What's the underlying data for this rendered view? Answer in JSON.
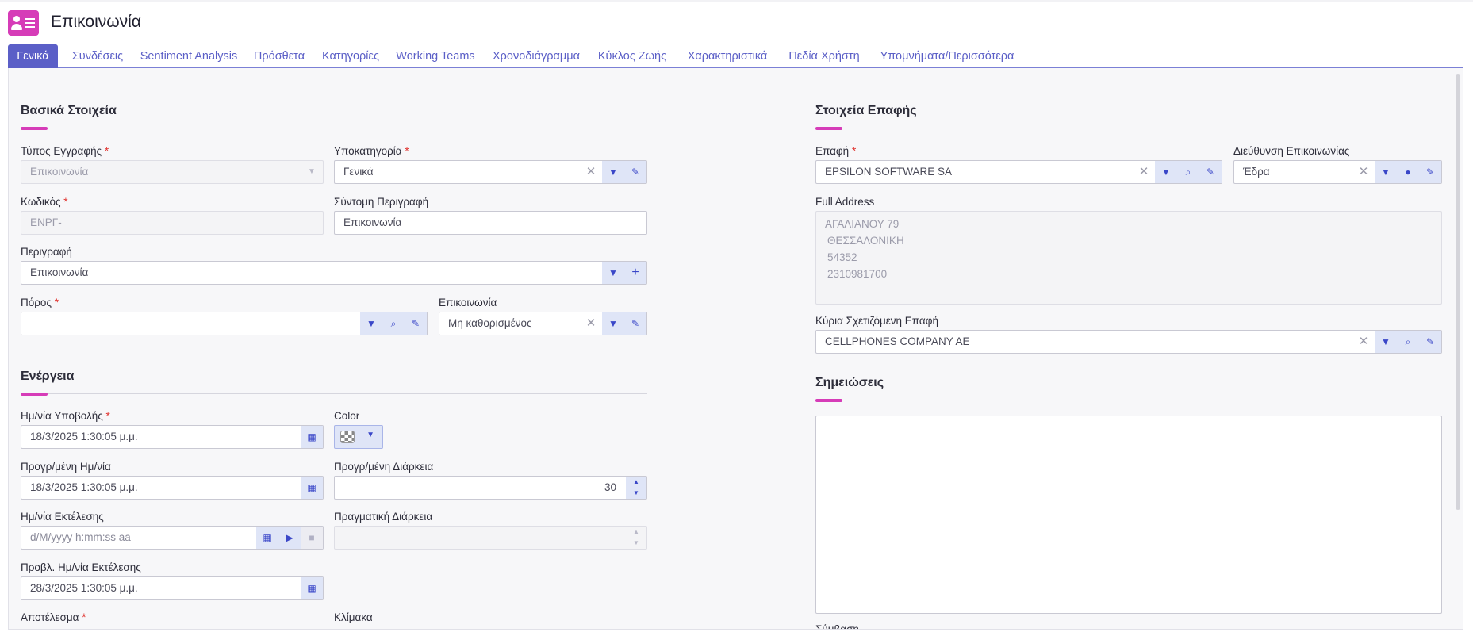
{
  "header": {
    "title": "Επικοινωνία",
    "icon": "contact-card-icon"
  },
  "tabs": [
    {
      "label": "Γενικά",
      "active": true
    },
    {
      "label": "Συνδέσεις"
    },
    {
      "label": "Sentiment Analysis"
    },
    {
      "label": "Πρόσθετα"
    },
    {
      "label": "Κατηγορίες"
    },
    {
      "label": "Working Teams"
    },
    {
      "label": "Χρονοδιάγραμμα"
    },
    {
      "label": "Κύκλος Ζωής"
    },
    {
      "label": "Χαρακτηριστικά"
    },
    {
      "label": "Πεδία Χρήστη"
    },
    {
      "label": "Υπομνήματα/Περισσότερα"
    }
  ],
  "basic": {
    "title": "Βασικά Στοιχεία",
    "record_type": {
      "label": "Τύπος Εγγραφής",
      "value": "Επικοινωνία"
    },
    "subcategory": {
      "label": "Υποκατηγορία",
      "value": "Γενικά"
    },
    "code": {
      "label": "Κωδικός",
      "value": "ΕΝΡΓ-________"
    },
    "short_desc": {
      "label": "Σύντομη Περιγραφή",
      "value": "Επικοινωνία"
    },
    "description": {
      "label": "Περιγραφή",
      "value": "Επικοινωνία"
    },
    "resource": {
      "label": "Πόρος",
      "value": ""
    },
    "communication": {
      "label": "Επικοινωνία",
      "value": "Μη καθορισμένος"
    }
  },
  "action": {
    "title": "Ενέργεια",
    "submit_date": {
      "label": "Ημ/νία Υποβολής",
      "value": "18/3/2025 1:30:05 μ.μ."
    },
    "color": {
      "label": "Color"
    },
    "planned_date": {
      "label": "Προγρ/μένη Ημ/νία",
      "value": "18/3/2025 1:30:05 μ.μ."
    },
    "planned_duration": {
      "label": "Προγρ/μένη Διάρκεια",
      "value": "30"
    },
    "exec_date": {
      "label": "Ημ/νία Εκτέλεσης",
      "placeholder": "d/M/yyyy h:mm:ss aa"
    },
    "actual_duration": {
      "label": "Πραγματική Διάρκεια",
      "value": ""
    },
    "forecast_exec_date": {
      "label": "Προβλ. Ημ/νία Εκτέλεσης",
      "value": "28/3/2025 1:30:05 μ.μ."
    },
    "result": {
      "label": "Αποτέλεσμα"
    },
    "scale": {
      "label": "Κλίμακα"
    }
  },
  "contact": {
    "title": "Στοιχεία Επαφής",
    "contact": {
      "label": "Επαφή",
      "value": "EPSILON SOFTWARE SA"
    },
    "address": {
      "label": "Διεύθυνση Επικοινωνίας",
      "value": "Έδρα"
    },
    "full_address": {
      "label": "Full Address",
      "lines": [
        "ΑΓΑΛΙΑΝΟΥ 79",
        "ΘΕΣΣΑΛΟΝΙΚΗ",
        "54352",
        "2310981700"
      ]
    },
    "main_related": {
      "label": "Κύρια Σχετιζόμενη Επαφή",
      "value": "CELLPHONES COMPANY AE"
    }
  },
  "notes": {
    "title": "Σημειώσεις",
    "value": ""
  },
  "contract": {
    "label": "Σύμβαση"
  }
}
